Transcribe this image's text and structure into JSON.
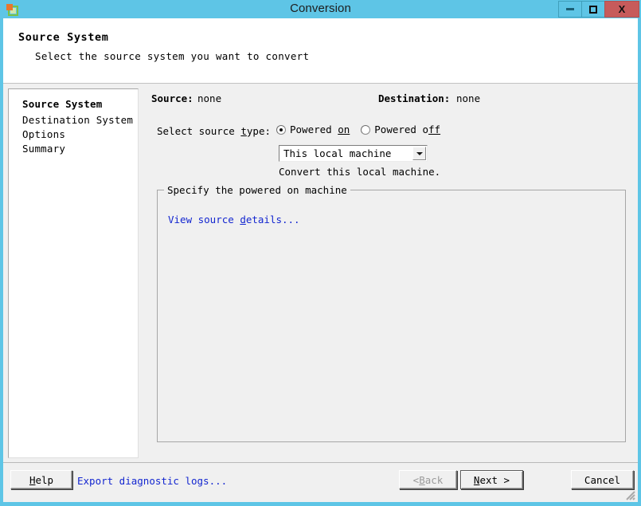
{
  "window": {
    "title": "Conversion",
    "app_icon": "converter-icon",
    "accent_color": "#5ec5e6",
    "close_color": "#c75b5b",
    "controls": {
      "minimize": "minimize-icon",
      "maximize": "maximize-icon",
      "close": "X"
    }
  },
  "header": {
    "title": "Source System",
    "subtitle": "Select the source system you want to convert"
  },
  "sidebar": {
    "items": [
      {
        "label": "Source System",
        "active": true
      },
      {
        "label": "Destination System",
        "active": false
      },
      {
        "label": "Options",
        "active": false
      },
      {
        "label": "Summary",
        "active": false
      }
    ]
  },
  "main": {
    "source_label": "Source:",
    "source_value": "none",
    "destination_label": "Destination:",
    "destination_value": "none",
    "select_type_label": "Select source type:",
    "radios": [
      {
        "label_before": "Powered ",
        "mnemonic": "on",
        "label_after": "",
        "checked": true
      },
      {
        "label_before": "Powered o",
        "mnemonic": "ff",
        "label_after": "",
        "checked": false
      }
    ],
    "dropdown": {
      "value": "This local machine",
      "arrow": "chevron-down-icon"
    },
    "dropdown_hint": "Convert this local machine.",
    "groupbox_title": "Specify the powered on machine",
    "view_details_before": "View source ",
    "view_details_mnemonic": "d",
    "view_details_after": "etails...",
    "link_color": "#1326d0"
  },
  "footer": {
    "help_before": "",
    "help_mnemonic": "H",
    "help_after": "elp",
    "export_before": "Export dia",
    "export_mnemonic": "g",
    "export_after": "nostic logs...",
    "back_before": "< ",
    "back_mnemonic": "B",
    "back_after": "ack",
    "next_before": "",
    "next_mnemonic": "N",
    "next_after": "ext >",
    "cancel_label": "Cancel"
  }
}
